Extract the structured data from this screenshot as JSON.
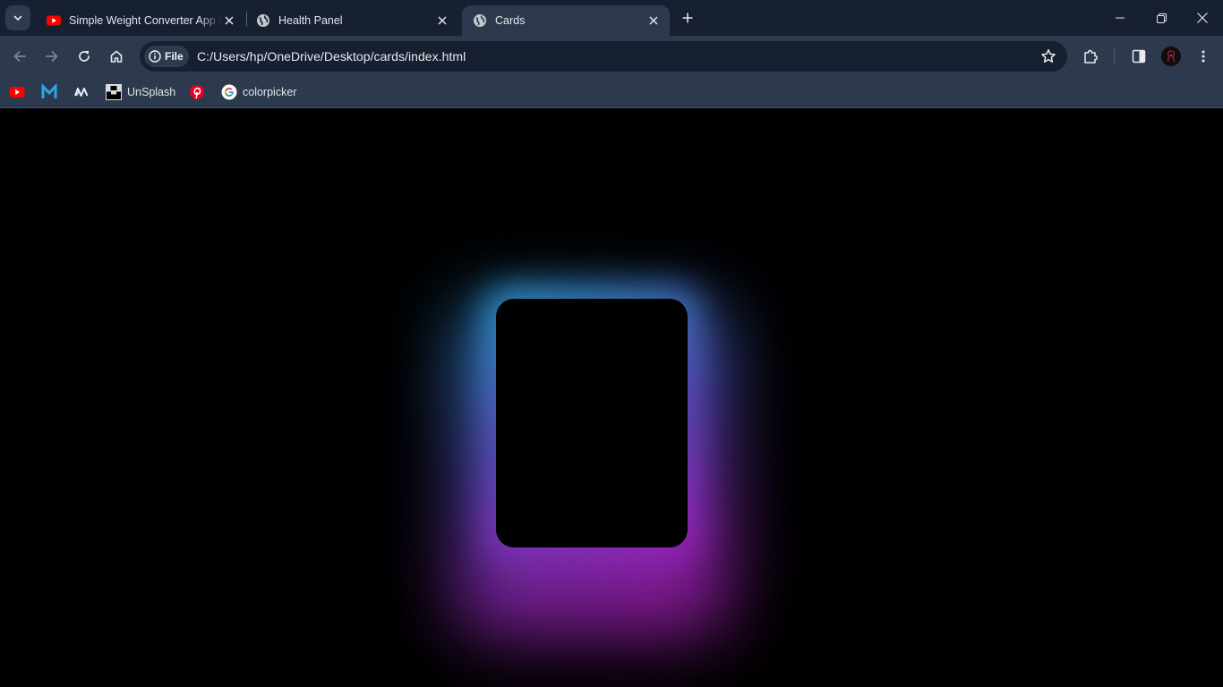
{
  "browser": {
    "tabs": [
      {
        "title": "Simple Weight Converter App W",
        "favicon": "youtube-icon",
        "active": false
      },
      {
        "title": "Health Panel",
        "favicon": "globe-icon",
        "active": false
      },
      {
        "title": "Cards",
        "favicon": "globe-icon",
        "active": true
      }
    ],
    "address": {
      "chip_label": "File",
      "url": "C:/Users/hp/OneDrive/Desktop/cards/index.html"
    },
    "bookmarks": [
      {
        "label": "",
        "icon": "youtube-icon"
      },
      {
        "label": "",
        "icon": "gmail-m-icon"
      },
      {
        "label": "",
        "icon": "logo-w-icon"
      },
      {
        "label": "UnSplash",
        "icon": "unsplash-icon"
      },
      {
        "label": "",
        "icon": "pinterest-icon"
      },
      {
        "label": "colorpicker",
        "icon": "google-icon"
      }
    ]
  },
  "page": {
    "background": "#000000",
    "card": {
      "color": "#000000",
      "glow_colors": [
        "#1f7fb0",
        "#4a3c9f",
        "#9a1aa2"
      ]
    }
  }
}
